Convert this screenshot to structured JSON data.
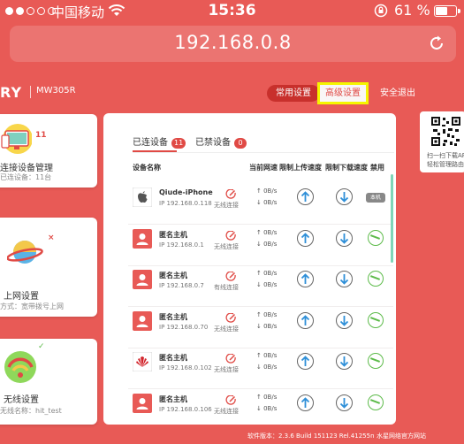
{
  "status_bar": {
    "carrier": "中国移动",
    "time": "15:36",
    "battery_percent": "61 %",
    "battery_level": 0.61,
    "signal_filled": 2,
    "signal_total": 5
  },
  "browser": {
    "url": "192.168.0.8",
    "reload_icon": "reload-icon"
  },
  "header": {
    "brand": "RY",
    "model": "MW305R",
    "nav": {
      "common": "常用设置",
      "advanced": "高级设置",
      "logout": "安全退出"
    }
  },
  "left_cards": [
    {
      "title": "连接设备管理",
      "sub": "已连设备：11台",
      "badge": "11",
      "icon": "monitor-devices-icon"
    },
    {
      "title": "上网设置",
      "sub": "方式：宽带拨号上网",
      "badge": "×",
      "icon": "planet-icon"
    },
    {
      "title": "无线设置",
      "sub": "无线名称：hit_test",
      "badge": "✓",
      "icon": "wifi-icon"
    }
  ],
  "qr": {
    "line1": "扫一扫下载AP",
    "line2": "轻松管理路由"
  },
  "main": {
    "tabs": [
      {
        "label": "已连设备",
        "count": "11"
      },
      {
        "label": "已禁设备",
        "count": "0"
      }
    ],
    "columns": {
      "name": "设备名称",
      "current_speed": "当前网速",
      "limit_up": "限制上传速度",
      "limit_down": "限制下载速度",
      "disable": "禁用"
    },
    "devices": [
      {
        "name": "Qiude-iPhone",
        "ip": "IP 192.168.0.118",
        "conn": "无线连接",
        "up": "0B/s",
        "down": "0B/s",
        "icon": "apple-icon",
        "local": "本机"
      },
      {
        "name": "匿名主机",
        "ip": "IP 192.168.0.1",
        "conn": "无线连接",
        "up": "0B/s",
        "down": "0B/s",
        "icon": "user-icon",
        "local": ""
      },
      {
        "name": "匿名主机",
        "ip": "IP 192.168.0.7",
        "conn": "有线连接",
        "up": "0B/s",
        "down": "0B/s",
        "icon": "user-icon",
        "local": ""
      },
      {
        "name": "匿名主机",
        "ip": "IP 192.168.0.70",
        "conn": "无线连接",
        "up": "0B/s",
        "down": "0B/s",
        "icon": "user-icon",
        "local": ""
      },
      {
        "name": "匿名主机",
        "ip": "IP 192.168.0.102",
        "conn": "无线连接",
        "up": "0B/s",
        "down": "0B/s",
        "icon": "huawei-icon",
        "local": ""
      },
      {
        "name": "匿名主机",
        "ip": "IP 192.168.0.106",
        "conn": "无线连接",
        "up": "0B/s",
        "down": "0B/s",
        "icon": "user-icon",
        "local": ""
      }
    ]
  },
  "footer": {
    "version": "软件版本：2.3.6 Build 151123 Rel.41255n",
    "site": "水星网络官方网站"
  },
  "colors": {
    "background": "#e85a56",
    "accent": "#e04a45",
    "highlight": "#f5f500",
    "green": "#5dbb4a"
  }
}
